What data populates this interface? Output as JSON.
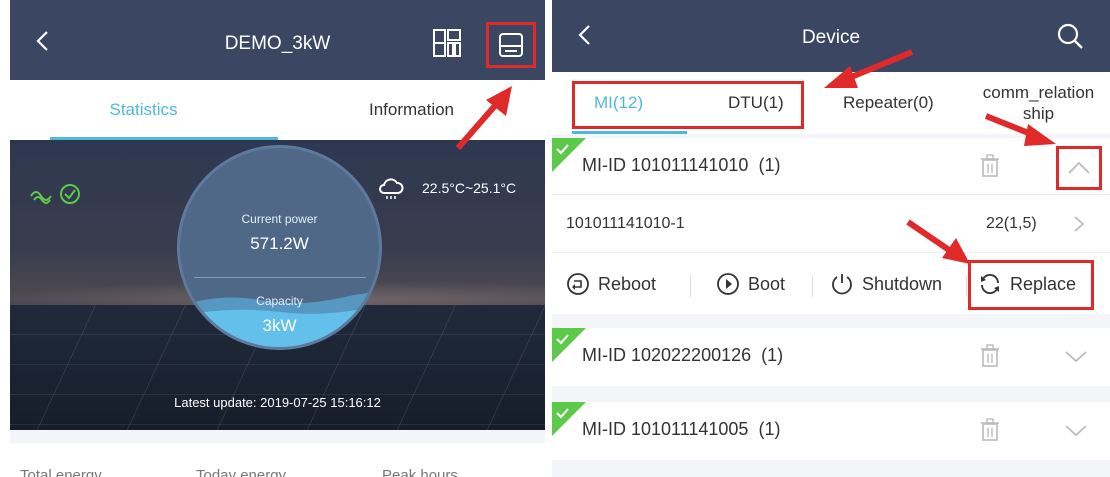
{
  "left_screen": {
    "header": {
      "title": "DEMO_3kW"
    },
    "tabs": {
      "statistics": "Statistics",
      "information": "Information"
    },
    "hero": {
      "weather": "22.5°C~25.1°C",
      "current_power_label": "Current power",
      "current_power_value": "571.2W",
      "capacity_label": "Capacity",
      "capacity_value": "3kW",
      "latest_update": "Latest update: 2019-07-25 15:16:12"
    },
    "bottom_stats": [
      "Total energy",
      "Today energy",
      "Peak hours"
    ]
  },
  "right_screen": {
    "header": {
      "title": "Device"
    },
    "tabs": {
      "mi": "MI(12)",
      "dtu": "DTU(1)",
      "repeater": "Repeater(0)",
      "comm_line1": "comm_relation",
      "comm_line2": "ship"
    },
    "devices": [
      {
        "mi_id": "MI-ID 101011141010",
        "count": "(1)",
        "expanded": true,
        "sub_id": "101011141010-1",
        "sub_value": "22(1,5)",
        "actions": {
          "reboot": "Reboot",
          "boot": "Boot",
          "shutdown": "Shutdown",
          "replace": "Replace"
        }
      },
      {
        "mi_id": "MI-ID 102022200126",
        "count": "(1)",
        "expanded": false
      },
      {
        "mi_id": "MI-ID 101011141005",
        "count": "(1)",
        "expanded": false
      }
    ]
  },
  "colors": {
    "header_bg": "#3b4663",
    "accent": "#4fb8dd",
    "highlight": "#e02a2a",
    "status_green": "#5cc94a"
  }
}
